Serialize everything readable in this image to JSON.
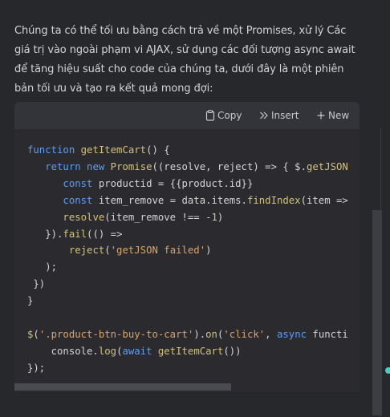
{
  "message": {
    "text": "Chúng ta có thể tối ưu bằng cách trả về một Promises, xử lý Các giá trị vào ngoài phạm vi AJAX, sử dụng các đối tượng async await để tăng hiệu suất cho code của chúng ta, dưới đây là một phiên bản tối ưu và tạo ra kết quả mong đợi:"
  },
  "toolbar": {
    "copy_label": "Copy",
    "insert_label": "Insert",
    "new_label": "New",
    "copy_icon": "clipboard-icon",
    "insert_icon": "double-chevron-icon",
    "new_icon": "plus-icon"
  },
  "code": {
    "language": "javascript",
    "lines": [
      "function getItemCart() {",
      "   return new Promise((resolve, reject) => { $.getJSON",
      "      const productid = {{product.id}}",
      "      const item_remove = data.items.findIndex(item =>",
      "      resolve(item_remove !== -1)",
      "   }).fail(() =>",
      "       reject('getJSON failed')",
      "   );",
      " })",
      "}",
      "",
      "$('.product-btn-buy-to-cart').on('click', async functi",
      "    console.log(await getItemCart())",
      "});"
    ]
  },
  "colors": {
    "background": "#27282c",
    "codeblock": "#2b2b2f",
    "toolbar": "#333439",
    "keyword": "#5c9cf5",
    "function": "#d2c07b",
    "string": "#d9a36b",
    "accent_dot": "#3fd0c8"
  }
}
